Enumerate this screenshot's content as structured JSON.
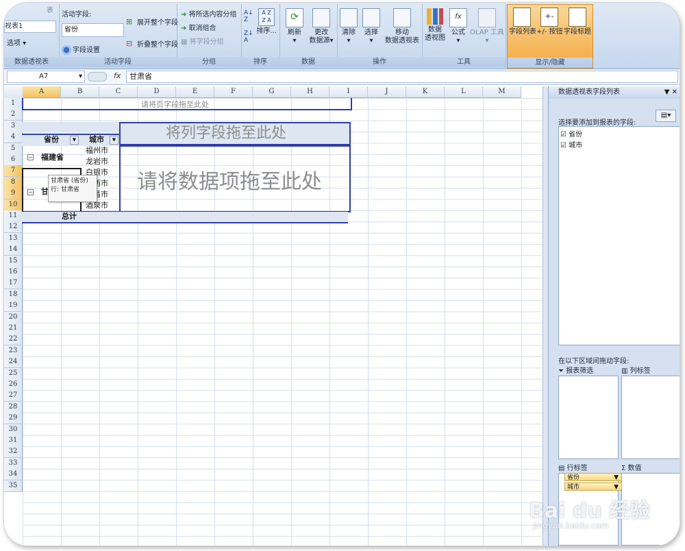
{
  "ribbon": {
    "pivot_table": {
      "name_cut": "视表1",
      "options": "选项",
      "group": "数据透视表",
      "label_cut": "表"
    },
    "active_field": {
      "label": "活动字段:",
      "value": "省份",
      "field_settings": "字段设置",
      "expand": "展开整个字段",
      "collapse": "折叠整个字段",
      "group": "活动字段"
    },
    "grouping": {
      "group_selection": "将所选内容分组",
      "ungroup": "取消组合",
      "group_field": "将字段分组",
      "group": "分组"
    },
    "sort": {
      "sort_label": "排序...",
      "group": "排序"
    },
    "data": {
      "refresh": "刷新",
      "change_source_1": "更改",
      "change_source_2": "数据源",
      "group": "数据"
    },
    "actions": {
      "clear": "清除",
      "select": "选择",
      "move_1": "移动",
      "move_2": "数据透视表",
      "group": "操作"
    },
    "tools": {
      "pivot_chart_1": "数据",
      "pivot_chart_2": "透视图",
      "formulas": "公式",
      "olap": "OLAP 工具",
      "group": "工具"
    },
    "show_hide": {
      "field_list": "字段列表",
      "buttons": "+/- 按钮",
      "headers": "字段标题",
      "group": "显示/隐藏"
    }
  },
  "formula_bar": {
    "name_box": "A7",
    "fx": "fx",
    "content": "甘肃省"
  },
  "columns": [
    "A",
    "B",
    "C",
    "D",
    "E",
    "F",
    "G",
    "H",
    "I",
    "J",
    "K",
    "L",
    "M"
  ],
  "rows": [
    "1",
    "2",
    "3",
    "4",
    "5",
    "6",
    "7",
    "8",
    "9",
    "10",
    "11",
    "12",
    "13",
    "14",
    "15",
    "16",
    "17",
    "18",
    "19",
    "20",
    "21",
    "22",
    "23",
    "24",
    "25",
    "26",
    "27",
    "28",
    "29",
    "30",
    "31",
    "32",
    "33",
    "34",
    "35"
  ],
  "pivot": {
    "page_drop": "请将页字段拖至此处",
    "col_drop": "将列字段拖至此处",
    "data_drop": "请将数据项拖至此处",
    "header_province": "省份",
    "header_city": "城市",
    "province_1": "福建省",
    "province_2_cut": "甘",
    "cities": [
      "福州市",
      "龙岩市",
      "白银市",
      "定西市",
      "金昌市",
      "酒泉市"
    ],
    "total": "总计",
    "tooltip_line1": "甘肃省 (省份)",
    "tooltip_line2": "行: 甘肃省"
  },
  "task_pane": {
    "title": "数据透视表字段列表",
    "choose_label": "选择要添加到报表的字段:",
    "fields": [
      {
        "label": "省份",
        "checked": true
      },
      {
        "label": "城市",
        "checked": true
      }
    ],
    "drag_label": "在以下区域间拖动字段:",
    "report_filter": "报表筛选",
    "column_labels": "列标签",
    "row_labels": "行标签",
    "values": "数值",
    "row_fields": [
      "省份",
      "城市"
    ]
  },
  "watermark": {
    "logo": "Bai du 经验",
    "url": "jingyan.baidu.com"
  }
}
